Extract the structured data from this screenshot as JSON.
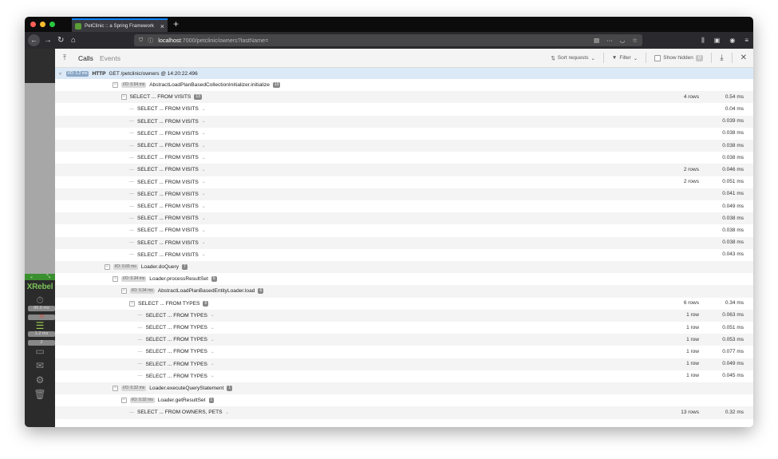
{
  "browser": {
    "tab_title": "PetClinic :: a Spring Framework",
    "url_host": "localhost",
    "url_path": ":7000/petclinic/owners?lastName=",
    "colors": {
      "tab_accent": "#0a84ff",
      "chrome_dark": "#2a2a2e"
    }
  },
  "xrebel": {
    "brand": "XRebel",
    "items": [
      {
        "icon": "stopwatch-icon",
        "count": "",
        "value": "86.5 ms"
      },
      {
        "icon": "database-icon",
        "count": "39",
        "value": "1.2 ms"
      },
      {
        "icon": "monitor-icon",
        "count": "2",
        "value": ""
      },
      {
        "icon": "envelope-icon",
        "count": "",
        "value": ""
      },
      {
        "icon": "gear-icon",
        "count": "",
        "value": ""
      },
      {
        "icon": "trash-icon",
        "count": "",
        "value": ""
      }
    ],
    "toolbar": {
      "tab_calls": "Calls",
      "tab_events": "Events",
      "sort_label": "Sort requests",
      "filter_label": "Filter",
      "show_hidden_label": "Show hidden",
      "hidden_count": "0"
    },
    "request": {
      "io": "I/O: 1.2 ms",
      "method": "HTTP",
      "text": "GET /petclinic/owners @ 14:20:22.496"
    },
    "tree": [
      {
        "depth": 0,
        "io": "I/O: 0.54 ms",
        "label": "AbstractLoadPlanBasedCollectionInitializer.initialize",
        "count": "13",
        "rows": "",
        "time": ""
      },
      {
        "depth": 1,
        "io": "",
        "label": "SELECT ... FROM VISITS",
        "count": "13",
        "rows": "4 rows",
        "time": "0.54 ms"
      },
      {
        "depth": 2,
        "io": "",
        "label": "SELECT ... FROM VISITS",
        "leaf": true,
        "rows": "",
        "time": "0.04 ms"
      },
      {
        "depth": 2,
        "io": "",
        "label": "SELECT ... FROM VISITS",
        "leaf": true,
        "rows": "",
        "time": "0.039 ms"
      },
      {
        "depth": 2,
        "io": "",
        "label": "SELECT ... FROM VISITS",
        "leaf": true,
        "rows": "",
        "time": "0.038 ms"
      },
      {
        "depth": 2,
        "io": "",
        "label": "SELECT ... FROM VISITS",
        "leaf": true,
        "rows": "",
        "time": "0.038 ms"
      },
      {
        "depth": 2,
        "io": "",
        "label": "SELECT ... FROM VISITS",
        "leaf": true,
        "rows": "",
        "time": "0.038 ms"
      },
      {
        "depth": 2,
        "io": "",
        "label": "SELECT ... FROM VISITS",
        "leaf": true,
        "rows": "2 rows",
        "time": "0.046 ms"
      },
      {
        "depth": 2,
        "io": "",
        "label": "SELECT ... FROM VISITS",
        "leaf": true,
        "rows": "2 rows",
        "time": "0.051 ms"
      },
      {
        "depth": 2,
        "io": "",
        "label": "SELECT ... FROM VISITS",
        "leaf": true,
        "rows": "",
        "time": "0.041 ms"
      },
      {
        "depth": 2,
        "io": "",
        "label": "SELECT ... FROM VISITS",
        "leaf": true,
        "rows": "",
        "time": "0.049 ms"
      },
      {
        "depth": 2,
        "io": "",
        "label": "SELECT ... FROM VISITS",
        "leaf": true,
        "rows": "",
        "time": "0.038 ms"
      },
      {
        "depth": 2,
        "io": "",
        "label": "SELECT ... FROM VISITS",
        "leaf": true,
        "rows": "",
        "time": "0.038 ms"
      },
      {
        "depth": 2,
        "io": "",
        "label": "SELECT ... FROM VISITS",
        "leaf": true,
        "rows": "",
        "time": "0.038 ms"
      },
      {
        "depth": 2,
        "io": "",
        "label": "SELECT ... FROM VISITS",
        "leaf": true,
        "rows": "",
        "time": "0.043 ms"
      },
      {
        "depth": -1,
        "io": "I/O: 0.66 ms",
        "label": "Loader.doQuery",
        "count": "7",
        "rows": "",
        "time": ""
      },
      {
        "depth": 0,
        "io": "I/O: 0.34 ms",
        "label": "Loader.processResultSet",
        "count": "6",
        "rows": "",
        "time": ""
      },
      {
        "depth": 1,
        "io": "I/O: 0.34 ms",
        "label": "AbstractLoadPlanBasedEntityLoader.load",
        "count": "6",
        "rows": "",
        "time": ""
      },
      {
        "depth": 2,
        "io": "",
        "label": "SELECT ... FROM TYPES",
        "count": "6",
        "rows": "6 rows",
        "time": "0.34 ms"
      },
      {
        "depth": 3,
        "io": "",
        "label": "SELECT ... FROM TYPES",
        "leaf": true,
        "rows": "1 row",
        "time": "0.063 ms"
      },
      {
        "depth": 3,
        "io": "",
        "label": "SELECT ... FROM TYPES",
        "leaf": true,
        "rows": "1 row",
        "time": "0.051 ms"
      },
      {
        "depth": 3,
        "io": "",
        "label": "SELECT ... FROM TYPES",
        "leaf": true,
        "rows": "1 row",
        "time": "0.053 ms"
      },
      {
        "depth": 3,
        "io": "",
        "label": "SELECT ... FROM TYPES",
        "leaf": true,
        "rows": "1 row",
        "time": "0.077 ms"
      },
      {
        "depth": 3,
        "io": "",
        "label": "SELECT ... FROM TYPES",
        "leaf": true,
        "rows": "1 row",
        "time": "0.049 ms"
      },
      {
        "depth": 3,
        "io": "",
        "label": "SELECT ... FROM TYPES",
        "leaf": true,
        "rows": "1 row",
        "time": "0.045 ms"
      },
      {
        "depth": 0,
        "io": "I/O: 0.32 ms",
        "label": "Loader.executeQueryStatement",
        "count": "1",
        "rows": "",
        "time": ""
      },
      {
        "depth": 1,
        "io": "I/O: 0.32 ms",
        "label": "Loader.getResultSet",
        "count": "1",
        "rows": "",
        "time": ""
      },
      {
        "depth": 2,
        "io": "",
        "label": "SELECT ... FROM OWNERS, PETS",
        "leaf": true,
        "rows": "13 rows",
        "time": "0.32 ms"
      }
    ]
  }
}
